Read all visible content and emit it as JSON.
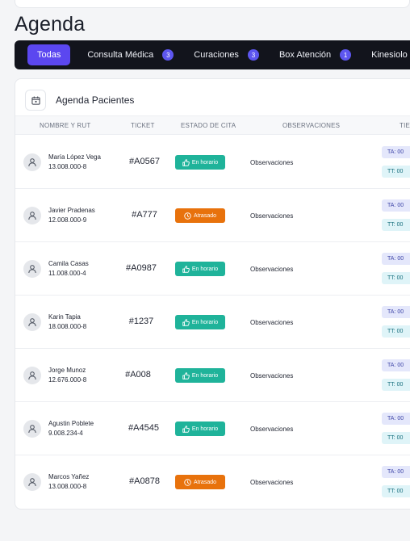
{
  "header": {
    "title": "Agenda"
  },
  "tabs": [
    {
      "label": "Todas",
      "badge": ""
    },
    {
      "label": "Consulta Médica",
      "badge": "3"
    },
    {
      "label": "Curaciones",
      "badge": "3"
    },
    {
      "label": "Box Atención",
      "badge": "1"
    },
    {
      "label": "Kinesiolo",
      "badge": ""
    }
  ],
  "card": {
    "title": "Agenda Pacientes",
    "columns": [
      "NOMBRE Y RUT",
      "TICKET",
      "ESTADO DE CITA",
      "OBSERVACIONES",
      "TIE"
    ]
  },
  "status_colors": {
    "on_time": "#1fb39a",
    "late": "#e8720c",
    "accent": "#5b47f0"
  },
  "rows": [
    {
      "name": "María López Vega",
      "rut": "13.008.000-8",
      "ticket": "#A0567",
      "status": "En horario",
      "status_kind": "on_time",
      "obs": "Observaciones",
      "ta": "TA: 00",
      "tt": "TT: 00"
    },
    {
      "name": "Javier Pradenas",
      "rut": "12.008.000-9",
      "ticket": "#A777",
      "status": "Atrasado",
      "status_kind": "late",
      "obs": "Observaciones",
      "ta": "TA: 00",
      "tt": "TT: 00"
    },
    {
      "name": "Camila Casas",
      "rut": "11.008.000-4",
      "ticket": "#A0987",
      "status": "En horario",
      "status_kind": "on_time",
      "obs": "Observaciones",
      "ta": "TA: 00",
      "tt": "TT: 00"
    },
    {
      "name": "Karin Tapia",
      "rut": "18.008.000-8",
      "ticket": "#1237",
      "status": "En horario",
      "status_kind": "on_time",
      "obs": "Observaciones",
      "ta": "TA: 00",
      "tt": "TT: 00"
    },
    {
      "name": "Jorge Munoz",
      "rut": "12.676.000-8",
      "ticket": "#A008",
      "status": "En horario",
      "status_kind": "on_time",
      "obs": "Observaciones",
      "ta": "TA: 00",
      "tt": "TT: 00"
    },
    {
      "name": "Agustin Poblete",
      "rut": "9.008.234-4",
      "ticket": "#A4545",
      "status": "En horario",
      "status_kind": "on_time",
      "obs": "Observaciones",
      "ta": "TA: 00",
      "tt": "TT: 00"
    },
    {
      "name": "Marcos Yañez",
      "rut": "13.008.000-8",
      "ticket": "#A0878",
      "status": "Atrasado",
      "status_kind": "late",
      "obs": "Observaciones",
      "ta": "TA: 00",
      "tt": "TT: 00"
    }
  ]
}
